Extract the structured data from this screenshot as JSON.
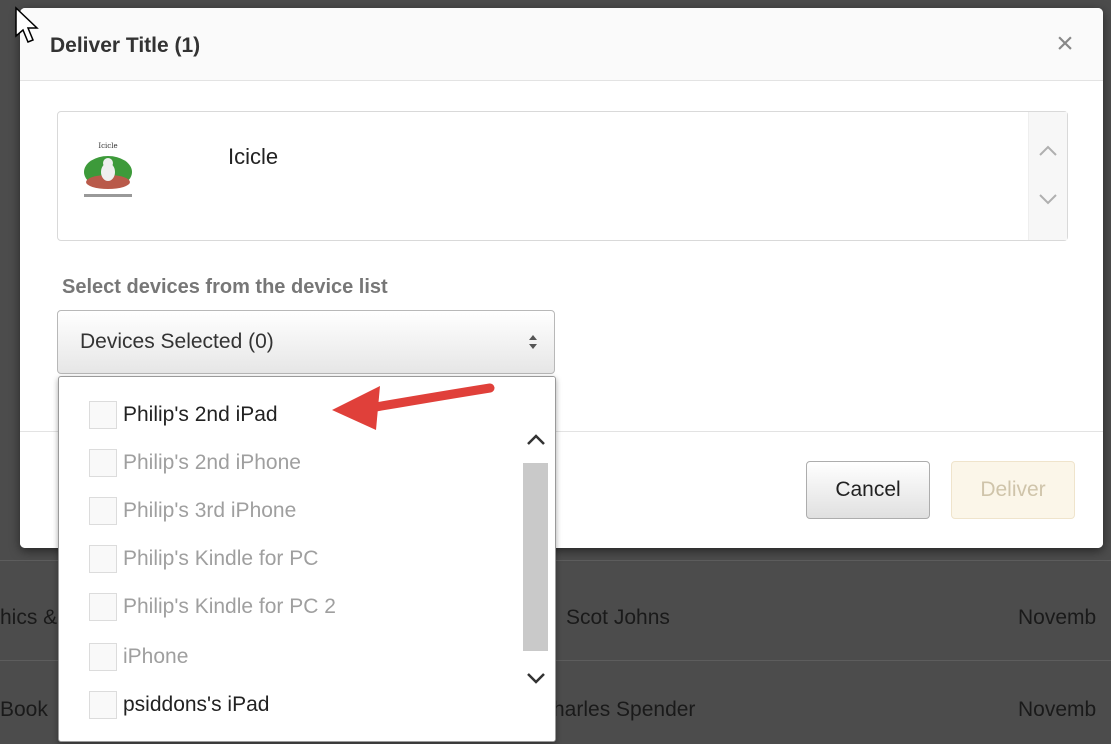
{
  "background": {
    "rows": [
      {
        "left": "hics &",
        "middle": "Scot Johns",
        "right": "Novemb"
      },
      {
        "left": "Book",
        "middle": "harles Spender",
        "right": "Novemb"
      }
    ]
  },
  "dialog": {
    "title": "Deliver Title (1)",
    "close_label": "×",
    "title_item": {
      "name": "Icicle"
    },
    "device_label": "Select devices from the device list",
    "device_select": {
      "value": "Devices Selected (0)"
    },
    "devices": [
      {
        "label": "Philip's 2nd iPad",
        "enabled": true
      },
      {
        "label": "Philip's 2nd iPhone",
        "enabled": false
      },
      {
        "label": "Philip's 3rd iPhone",
        "enabled": false
      },
      {
        "label": "Philip's Kindle for PC",
        "enabled": false
      },
      {
        "label": "Philip's Kindle for PC 2",
        "enabled": false
      },
      {
        "label": "iPhone",
        "enabled": false
      },
      {
        "label": "psiddons's iPad",
        "enabled": true
      }
    ],
    "buttons": {
      "cancel": "Cancel",
      "deliver": "Deliver"
    }
  },
  "colors": {
    "annotation_arrow": "#e0403a",
    "deliver_disabled_bg": "#fbf6e9"
  }
}
